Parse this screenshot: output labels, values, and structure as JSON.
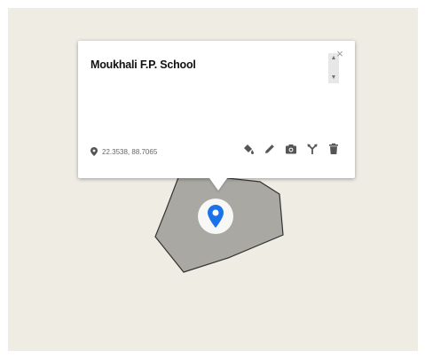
{
  "popup": {
    "title": "Moukhali F.P. School",
    "coordinates": "22.3538, 88.7065",
    "close_symbol": "×",
    "scroll_up_symbol": "▲",
    "scroll_down_symbol": "▼",
    "toolbar": [
      {
        "name": "paint-bucket-icon"
      },
      {
        "name": "pencil-icon"
      },
      {
        "name": "camera-icon"
      },
      {
        "name": "route-icon"
      },
      {
        "name": "trash-icon"
      }
    ]
  },
  "marker": {
    "icon": "location-pin-icon",
    "color": "#1a73e8"
  },
  "polygon": {
    "fill": "#a9a8a2",
    "stroke": "#333333"
  },
  "colors": {
    "map_background": "#efece4",
    "icon": "#555555"
  }
}
